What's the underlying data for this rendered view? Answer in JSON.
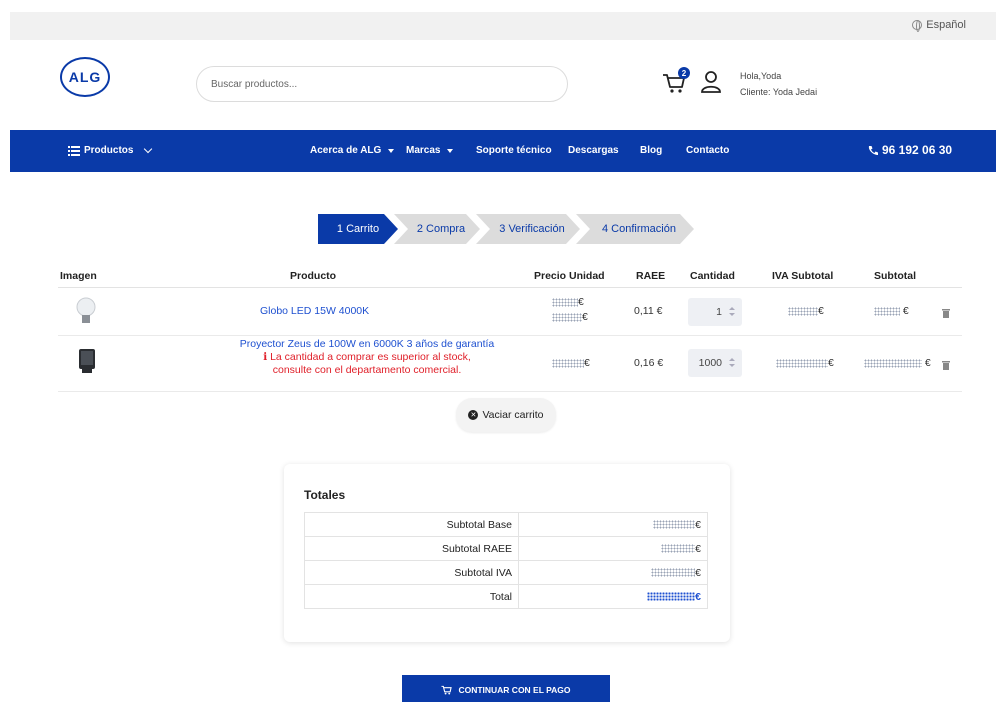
{
  "topbar": {
    "language": "Español"
  },
  "header": {
    "logo_text": "ALG",
    "search_placeholder": "Buscar productos...",
    "cart_count": "2",
    "greeting": "Hola,Yoda",
    "client": "Cliente: Yoda Jedai"
  },
  "nav": {
    "products": "Productos",
    "items": [
      "Acerca de ALG",
      "Marcas",
      "Soporte técnico",
      "Descargas",
      "Blog",
      "Contacto"
    ],
    "phone": "96 192 06 30"
  },
  "steps": [
    "1 Carrito",
    "2 Compra",
    "3 Verificación",
    "4 Confirmación"
  ],
  "cart": {
    "headers": {
      "image": "Imagen",
      "product": "Producto",
      "unit_price": "Precio Unidad",
      "raee": "RAEE",
      "quantity": "Cantidad",
      "iva_subtotal": "IVA Subtotal",
      "subtotal": "Subtotal"
    },
    "rows": [
      {
        "product": "Globo LED 15W 4000K",
        "raee": "0,11 €",
        "quantity": "1"
      },
      {
        "product": "Proyector Zeus de 100W en 6000K 3 años de garantía",
        "warning_line1": "La cantidad a comprar es superior al stock,",
        "warning_line2": "consulte con el departamento comercial.",
        "raee": "0,16 €",
        "quantity": "1000"
      }
    ],
    "currency": "€",
    "empty_button": "Vaciar carrito"
  },
  "totals": {
    "title": "Totales",
    "labels": [
      "Subtotal Base",
      "Subtotal RAEE",
      "Subtotal IVA",
      "Total"
    ]
  },
  "checkout_button": "CONTINUAR CON EL PAGO",
  "colors": {
    "primary": "#0a3aa8",
    "warning": "#e0202a"
  }
}
